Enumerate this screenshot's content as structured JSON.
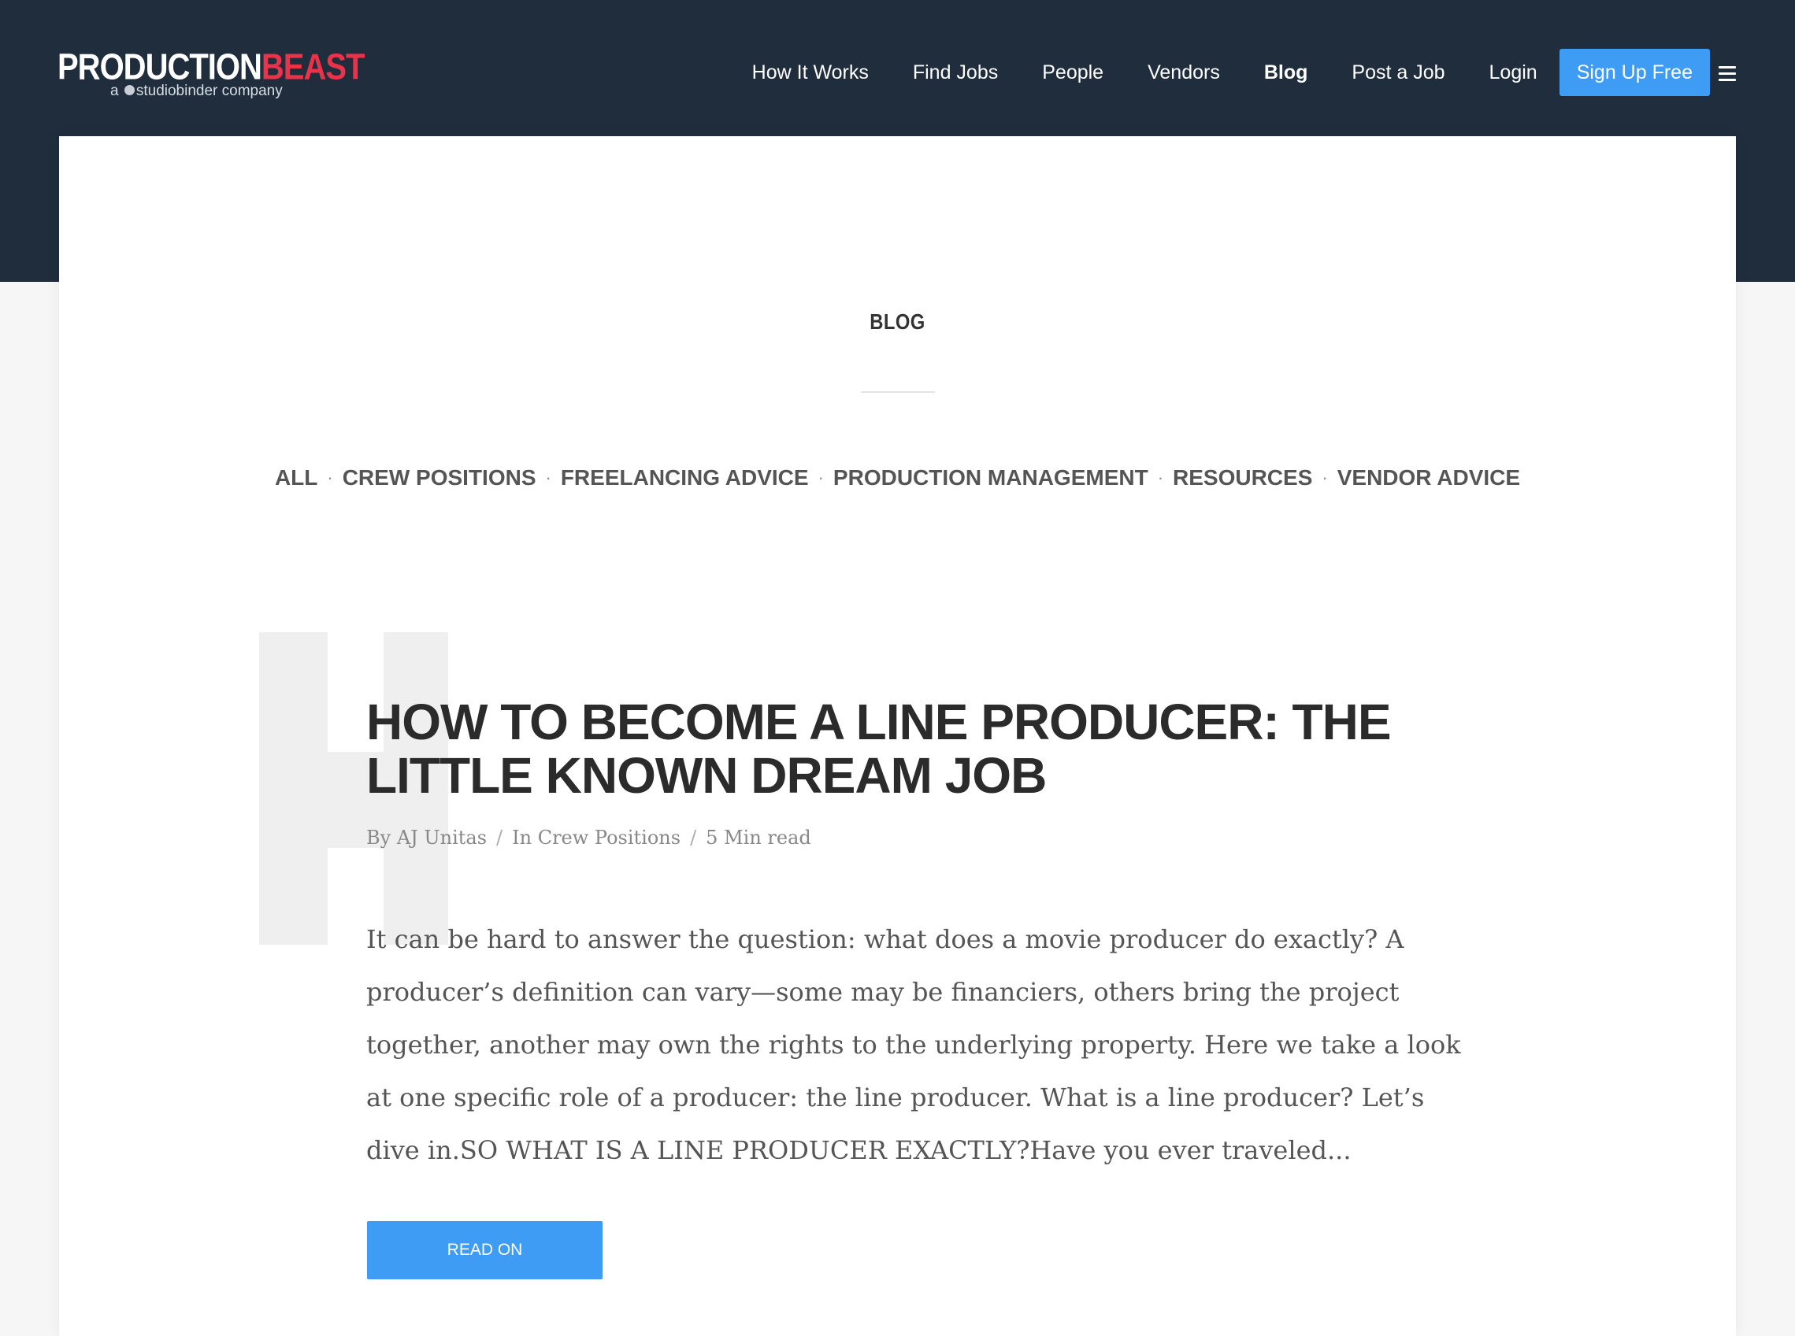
{
  "header": {
    "logo_primary": "PRODUCTION",
    "logo_accent": "BEAST",
    "logo_sub_prefix": "a",
    "logo_sub_suffix": "studiobinder company",
    "nav": [
      {
        "label": "How It Works"
      },
      {
        "label": "Find Jobs"
      },
      {
        "label": "People"
      },
      {
        "label": "Vendors"
      },
      {
        "label": "Blog",
        "active": true
      },
      {
        "label": "Post a Job"
      },
      {
        "label": "Login"
      }
    ],
    "signup_label": "Sign Up Free",
    "menu_icon": "hamburger-icon"
  },
  "blog": {
    "section_title": "BLOG",
    "categories": [
      "ALL",
      "CREW POSITIONS",
      "FREELANCING ADVICE",
      "PRODUCTION MANAGEMENT",
      "RESOURCES",
      "VENDOR ADVICE"
    ],
    "category_separator": "·"
  },
  "post": {
    "title": "HOW TO BECOME A LINE PRODUCER: THE LITTLE KNOWN DREAM JOB",
    "author": "By AJ Unitas",
    "category": "In Crew Positions",
    "read_time": "5 Min read",
    "meta_separator": "/",
    "excerpt": "It can be hard to answer the question: what does a movie producer do exactly? A producer’s definition can vary—some may be financiers, others bring the project together, another may own the rights to the underlying property. Here we take a look at one specific role of a producer: the line producer. What is a line producer? Let’s dive in.SO WHAT IS A LINE PRODUCER EXACTLY?Have you ever traveled...",
    "read_more_label": "READ ON"
  },
  "colors": {
    "header_bg": "#1f2d3d",
    "accent_red": "#e8334a",
    "button_blue": "#3f9cf5"
  }
}
